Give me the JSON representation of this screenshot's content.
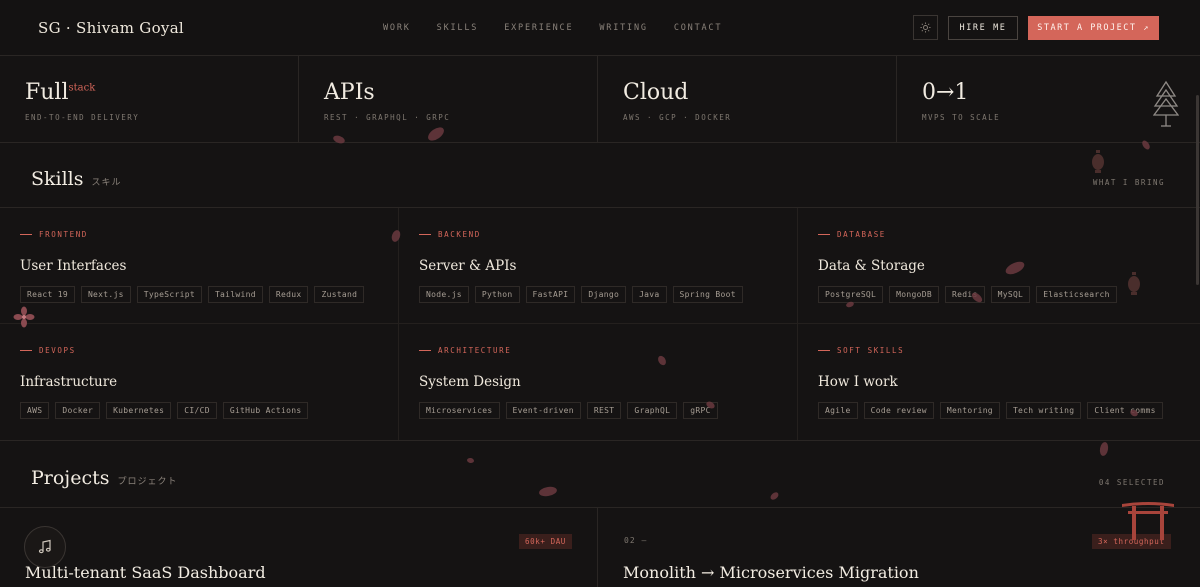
{
  "header": {
    "logo": "SG · Shivam Goyal",
    "nav": [
      "WORK",
      "SKILLS",
      "EXPERIENCE",
      "WRITING",
      "CONTACT"
    ],
    "hire_label": "HIRE ME",
    "cta_label": "START A PROJECT ↗",
    "theme_icon": "sun-icon"
  },
  "stats": [
    {
      "value": "Full",
      "sup": "stack",
      "label": "END-TO-END DELIVERY"
    },
    {
      "value": "APIs",
      "sup": "",
      "label": "REST · GRAPHQL · GRPC"
    },
    {
      "value": "Cloud",
      "sup": "",
      "label": "AWS · GCP · DOCKER"
    },
    {
      "value": "0→1",
      "sup": "",
      "label": "MVPS TO SCALE"
    }
  ],
  "skills": {
    "title": "Skills",
    "jp": "スキル",
    "right": "WHAT I BRING",
    "cards": [
      {
        "category": "FRONTEND",
        "title": "User Interfaces",
        "tags": [
          "React 19",
          "Next.js",
          "TypeScript",
          "Tailwind",
          "Redux",
          "Zustand"
        ]
      },
      {
        "category": "BACKEND",
        "title": "Server & APIs",
        "tags": [
          "Node.js",
          "Python",
          "FastAPI",
          "Django",
          "Java",
          "Spring Boot"
        ]
      },
      {
        "category": "DATABASE",
        "title": "Data & Storage",
        "tags": [
          "PostgreSQL",
          "MongoDB",
          "Redis",
          "MySQL",
          "Elasticsearch"
        ]
      },
      {
        "category": "DEVOPS",
        "title": "Infrastructure",
        "tags": [
          "AWS",
          "Docker",
          "Kubernetes",
          "CI/CD",
          "GitHub Actions"
        ]
      },
      {
        "category": "ARCHITECTURE",
        "title": "System Design",
        "tags": [
          "Microservices",
          "Event-driven",
          "REST",
          "GraphQL",
          "gRPC"
        ]
      },
      {
        "category": "SOFT SKILLS",
        "title": "How I work",
        "tags": [
          "Agile",
          "Code review",
          "Mentoring",
          "Tech writing",
          "Client comms"
        ]
      }
    ]
  },
  "projects": {
    "title": "Projects",
    "jp": "プロジェクト",
    "right": "04 SELECTED",
    "items": [
      {
        "num": "",
        "badge": "60k+ DAU",
        "title": "Multi-tenant SaaS Dashboard"
      },
      {
        "num": "02 —",
        "badge": "3× throughput",
        "title": "Monolith → Microservices Migration"
      }
    ]
  },
  "icons": {
    "music": "music-note-icon",
    "pagoda": "pagoda-icon",
    "torii": "torii-gate-icon",
    "lantern": "lantern-icon",
    "flower": "sakura-flower-icon"
  },
  "colors": {
    "accent": "#d4665a",
    "background": "#151313",
    "text": "#ece6dc",
    "muted": "#7f7870"
  }
}
